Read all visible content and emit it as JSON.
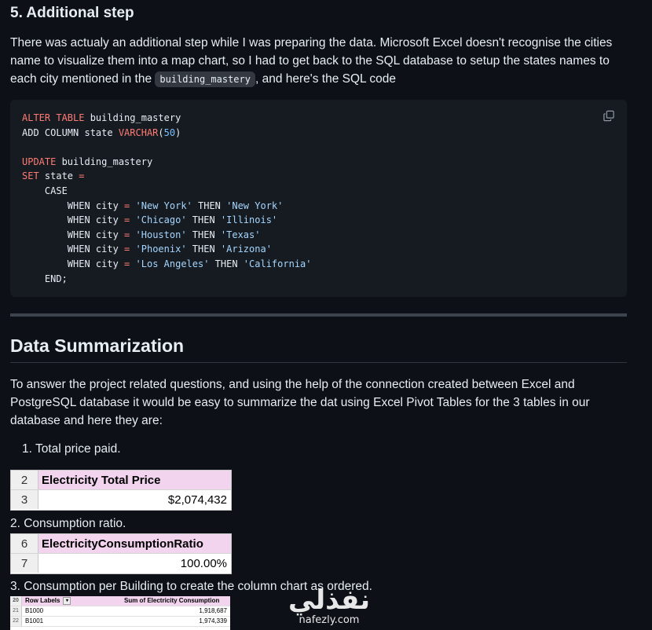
{
  "step": {
    "title": "5. Additional step"
  },
  "intro": {
    "text_before": "There was actualy an additional step while I was preparing the data. Microsoft Excel doesn't recognise the cities name to visualize them into a map chart, so I had to get back to the SQL database to setup the states names to each city mentioned in the ",
    "inline_code": "building_mastery",
    "text_after": ", and here's the SQL code"
  },
  "code": {
    "lines": [
      [
        {
          "t": "ALTER TABLE",
          "c": "kw"
        },
        {
          "t": " building_mastery"
        }
      ],
      [
        {
          "t": "ADD COLUMN state "
        },
        {
          "t": "VARCHAR",
          "c": "kw"
        },
        {
          "t": "("
        },
        {
          "t": "50",
          "c": "num"
        },
        {
          "t": ")"
        }
      ],
      [
        {
          "t": ""
        }
      ],
      [
        {
          "t": "UPDATE",
          "c": "kw"
        },
        {
          "t": " building_mastery"
        }
      ],
      [
        {
          "t": "SET",
          "c": "kw"
        },
        {
          "t": " state "
        },
        {
          "t": "=",
          "c": "kw"
        }
      ],
      [
        {
          "t": "    CASE"
        }
      ],
      [
        {
          "t": "        WHEN city "
        },
        {
          "t": "=",
          "c": "kw"
        },
        {
          "t": " "
        },
        {
          "t": "'New York'",
          "c": "str"
        },
        {
          "t": " THEN "
        },
        {
          "t": "'New York'",
          "c": "str"
        }
      ],
      [
        {
          "t": "        WHEN city "
        },
        {
          "t": "=",
          "c": "kw"
        },
        {
          "t": " "
        },
        {
          "t": "'Chicago'",
          "c": "str"
        },
        {
          "t": " THEN "
        },
        {
          "t": "'Illinois'",
          "c": "str"
        }
      ],
      [
        {
          "t": "        WHEN city "
        },
        {
          "t": "=",
          "c": "kw"
        },
        {
          "t": " "
        },
        {
          "t": "'Houston'",
          "c": "str"
        },
        {
          "t": " THEN "
        },
        {
          "t": "'Texas'",
          "c": "str"
        }
      ],
      [
        {
          "t": "        WHEN city "
        },
        {
          "t": "=",
          "c": "kw"
        },
        {
          "t": " "
        },
        {
          "t": "'Phoenix'",
          "c": "str"
        },
        {
          "t": " THEN "
        },
        {
          "t": "'Arizona'",
          "c": "str"
        }
      ],
      [
        {
          "t": "        WHEN city "
        },
        {
          "t": "=",
          "c": "kw"
        },
        {
          "t": " "
        },
        {
          "t": "'Los Angeles'",
          "c": "str"
        },
        {
          "t": " THEN "
        },
        {
          "t": "'California'",
          "c": "str"
        }
      ],
      [
        {
          "t": "    END;"
        }
      ]
    ],
    "copy_icon": "copy-icon"
  },
  "section": {
    "title": "Data Summarization"
  },
  "summary": {
    "text": "To answer the project related questions, and using the help of the connection created between Excel and PostgreSQL database it would be easy to summarize the dat using Excel Pivot Tables for the 3 tables in our database and here they are:"
  },
  "list": {
    "item1": "1. Total price paid.",
    "item2": "2. Consumption ratio.",
    "item3": "3. Consumption per Building to create the column chart as ordered."
  },
  "table1": {
    "header_row": "2",
    "header": "Electricity Total  Price",
    "value_row": "3",
    "value": "$2,074,432"
  },
  "table2": {
    "header_row": "6",
    "header": "ElectricityConsumptionRatio",
    "value_row": "7",
    "value": "100.00%"
  },
  "pivot": {
    "header_row": "20",
    "label_header": "Row Labels",
    "value_header": "Sum of Electricity Consumption",
    "rows": [
      {
        "rn": "21",
        "label": "B1000",
        "value": "1,918,687"
      },
      {
        "rn": "22",
        "label": "B1001",
        "value": "1,974,339"
      }
    ]
  },
  "watermark": {
    "arabic": "نفذلي",
    "latin": "nafezly.com"
  },
  "colors": {
    "background": "#0d1117",
    "code_bg": "#161b22",
    "keyword": "#ff7b72",
    "string": "#a5d6ff",
    "number": "#79c0ff",
    "excel_header": "#f2d4ee"
  }
}
